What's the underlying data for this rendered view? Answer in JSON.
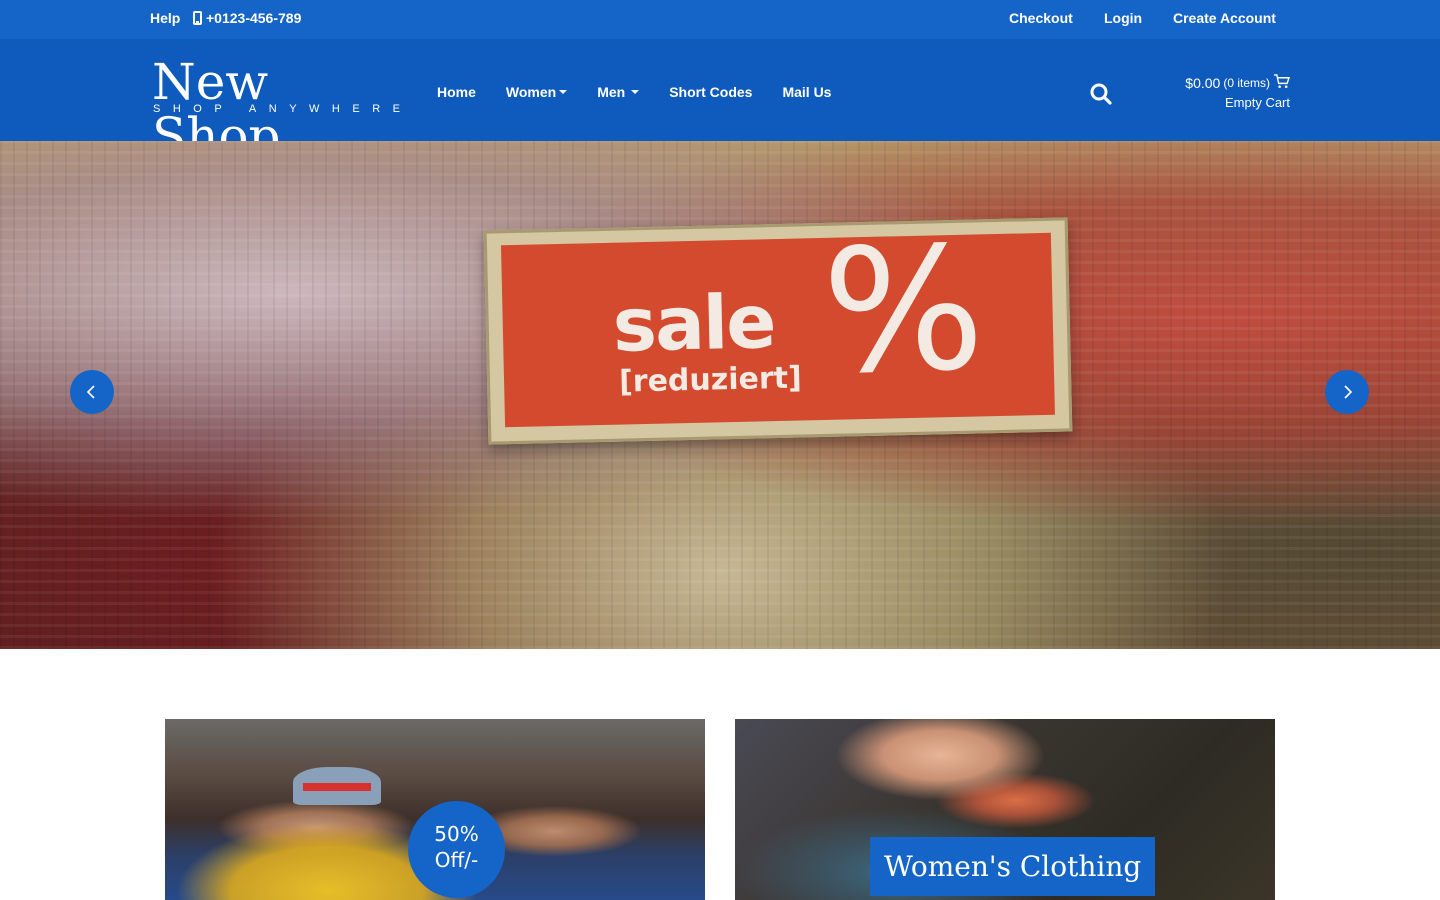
{
  "topbar": {
    "help_label": "Help",
    "phone": "+0123-456-789",
    "checkout_label": "Checkout",
    "login_label": "Login",
    "create_account_label": "Create Account"
  },
  "header": {
    "logo_title": "New Shop",
    "logo_tagline": "SHOP ANYWHERE",
    "nav": [
      {
        "label": "Home",
        "dropdown": false
      },
      {
        "label": "Women",
        "dropdown": true
      },
      {
        "label": "Men",
        "dropdown": true
      },
      {
        "label": "Short Codes",
        "dropdown": false
      },
      {
        "label": "Mail Us",
        "dropdown": false
      }
    ],
    "search_icon": "search-icon",
    "cart": {
      "amount": "$0.00",
      "items": "(0 items)",
      "status": "Empty Cart",
      "icon": "cart-icon"
    }
  },
  "hero": {
    "sign_word": "sale",
    "sign_sub": "[reduziert]",
    "sign_symbol": "%",
    "prev_icon": "chevron-left-icon",
    "next_icon": "chevron-right-icon"
  },
  "promos": {
    "men_badge_line1": "50%",
    "men_badge_line2": "Off/-",
    "women_label": "Women's Clothing"
  },
  "colors": {
    "primary": "#1565c8",
    "header": "#0f5bbd",
    "sign_red": "#d44a2e"
  }
}
